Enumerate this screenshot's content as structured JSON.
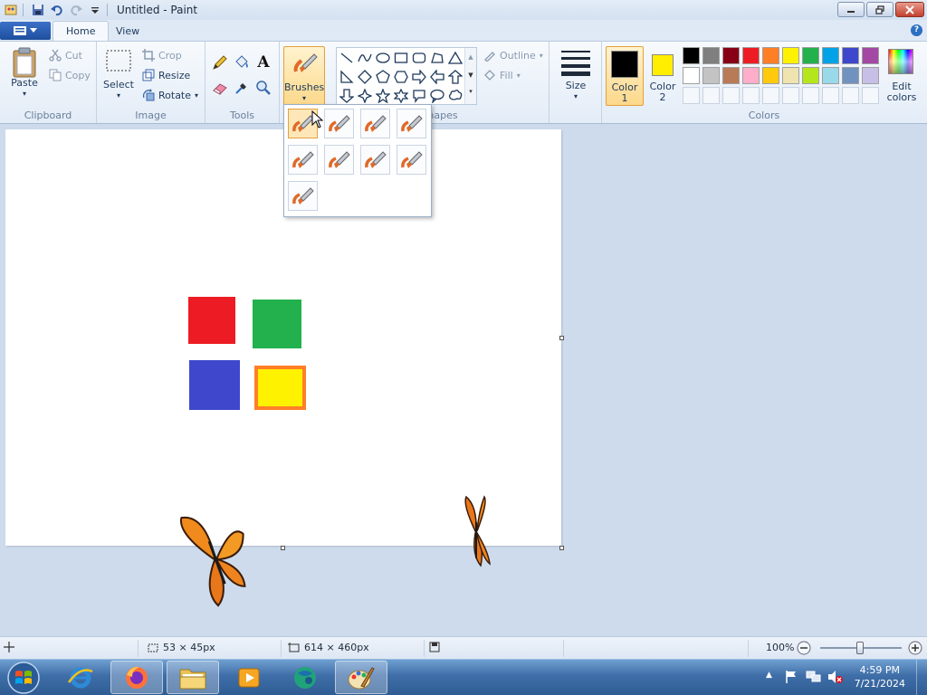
{
  "window": {
    "title": "Untitled - Paint"
  },
  "tabs": [
    {
      "label": "Home",
      "active": true
    },
    {
      "label": "View",
      "active": false
    }
  ],
  "ribbon": {
    "clipboard": {
      "group_label": "Clipboard",
      "paste": "Paste",
      "cut": "Cut",
      "copy": "Copy"
    },
    "image": {
      "group_label": "Image",
      "select": "Select",
      "crop": "Crop",
      "resize": "Resize",
      "rotate": "Rotate"
    },
    "tools": {
      "group_label": "Tools"
    },
    "brushes": {
      "label": "Brushes"
    },
    "shapes": {
      "group_label": "Shapes",
      "outline": "Outline",
      "fill": "Fill"
    },
    "size": {
      "label": "Size"
    },
    "colors": {
      "group_label": "Colors",
      "color1_label_a": "Color",
      "color1_label_b": "1",
      "color2_label_a": "Color",
      "color2_label_b": "2",
      "color1": "#000000",
      "color2": "#ffee00",
      "edit_a": "Edit",
      "edit_b": "colors",
      "palette_row1": [
        "#000000",
        "#7f7f7f",
        "#880015",
        "#ed1c24",
        "#ff7f27",
        "#fff200",
        "#22b14c",
        "#00a2e8",
        "#3f48cc",
        "#a349a4"
      ],
      "palette_row2": [
        "#ffffff",
        "#c3c3c3",
        "#b97a57",
        "#ffaec9",
        "#ffc90e",
        "#efe4b0",
        "#b5e61d",
        "#99d9ea",
        "#7092be",
        "#c8bfe7"
      ]
    }
  },
  "canvas": {
    "squares": [
      {
        "name": "red-square",
        "color": "#ed1c24"
      },
      {
        "name": "green-square",
        "color": "#22b14c"
      },
      {
        "name": "blue-square",
        "color": "#3f48cc"
      },
      {
        "name": "yellow-square",
        "color": "#fff200",
        "border": "#ff7f27"
      }
    ]
  },
  "brush_menu": {
    "count": 9,
    "selected_index": 0
  },
  "status": {
    "selection_size": "53 × 45px",
    "image_size": "614 × 460px",
    "zoom": "100%"
  },
  "taskbar": {
    "time": "4:59 PM",
    "date": "7/21/2024"
  }
}
